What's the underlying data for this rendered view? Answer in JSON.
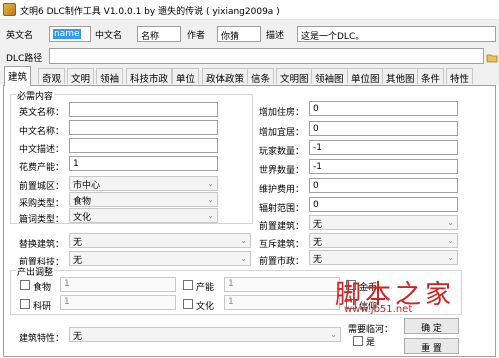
{
  "title": "文明6 DLC制作工具 V1.0.0.1 by 遗失的传说 ( yixiang2009a )",
  "top": {
    "en_name_label": "英文名",
    "en_name_value": "name",
    "cn_name_label": "中文名",
    "cn_name_value": "名称",
    "author_label": "作者",
    "author_value": "你猜",
    "desc_label": "描述",
    "desc_value": "这是一个DLC。",
    "dlc_path_label": "DLC路径",
    "dlc_path_value": ""
  },
  "tabs": [
    "建筑",
    "奇观",
    "文明",
    "领袖",
    "科技市政",
    "单位",
    "政体政策",
    "信条",
    "文明图",
    "领袖图",
    "单位图",
    "其他图",
    "条件",
    "特性"
  ],
  "active_tab": "建筑",
  "panel": {
    "required_title": "必需内容",
    "left_fields": [
      {
        "label": "英文名称：",
        "value": ""
      },
      {
        "label": "中文名称：",
        "value": ""
      },
      {
        "label": "中文描述：",
        "value": ""
      },
      {
        "label": "花费产能：",
        "value": "1"
      }
    ],
    "left_selects": [
      {
        "label": "前置城区：",
        "value": "市中心"
      },
      {
        "label": "采购类型：",
        "value": "食物"
      },
      {
        "label": "篇词类型：",
        "value": "文化"
      }
    ],
    "right_fields": [
      {
        "label": "增加住房：",
        "value": "0"
      },
      {
        "label": "增加宜居：",
        "value": "0"
      },
      {
        "label": "玩家数量：",
        "value": "-1"
      },
      {
        "label": "世界数量：",
        "value": "-1"
      },
      {
        "label": "维护费用：",
        "value": "0"
      },
      {
        "label": "辐射范围：",
        "value": "0"
      }
    ],
    "right_selects": [
      {
        "label": "前置建筑：",
        "value": "无"
      },
      {
        "label": "互斥建筑：",
        "value": "无"
      },
      {
        "label": "前置市政：",
        "value": "无"
      }
    ],
    "replace_building_label": "替换建筑：",
    "replace_building_value": "无",
    "prereq_tech_label": "前置科技：",
    "prereq_tech_value": "无",
    "output_title": "产出调整",
    "outputs": [
      {
        "label": "食物",
        "value": "1"
      },
      {
        "label": "产能",
        "value": "1"
      },
      {
        "label": "金币",
        "value": ""
      },
      {
        "label": "科研",
        "value": "1"
      },
      {
        "label": "文化",
        "value": "1"
      },
      {
        "label": "信仰",
        "value": ""
      }
    ],
    "trait_label": "建筑特性：",
    "trait_value": "无",
    "need_ocean_label": "需要临河：",
    "is_label": "是",
    "confirm_label": "确 定",
    "reset_label": "重 置"
  },
  "watermark_cn": "脚本之家",
  "watermark_url": "www.jb51.net"
}
